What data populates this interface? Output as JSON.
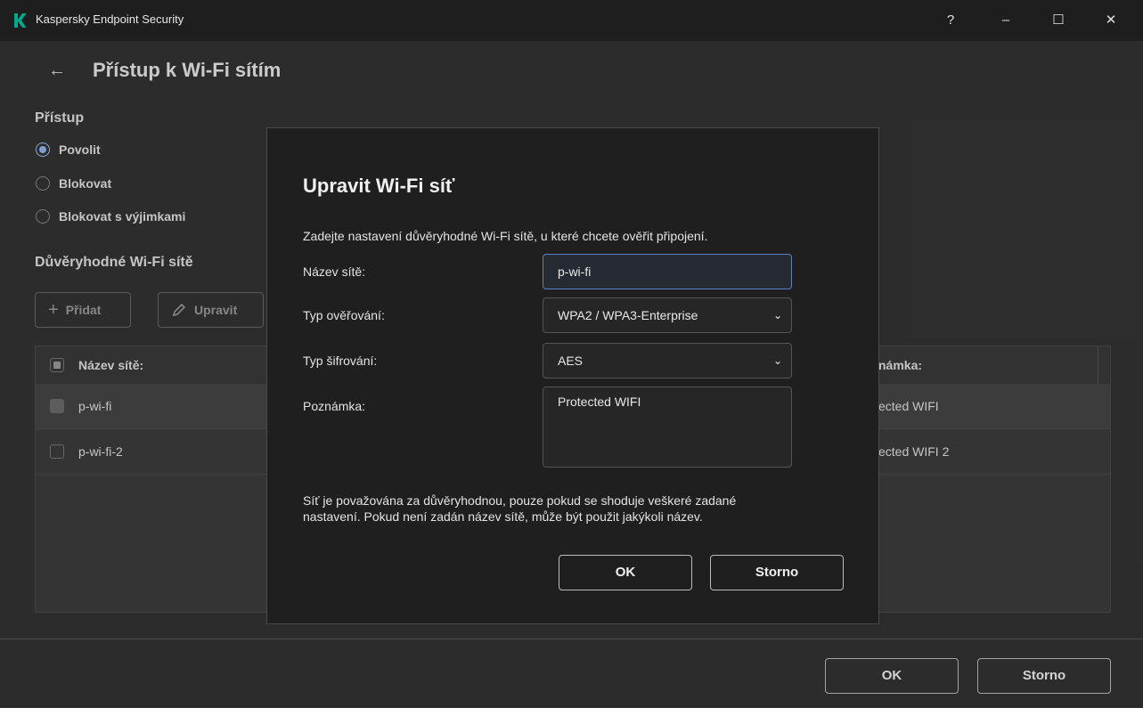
{
  "titlebar": {
    "app_title": "Kaspersky Endpoint Security",
    "help": "?",
    "minimize": "–",
    "maximize": "☐",
    "close": "✕"
  },
  "page": {
    "back_icon": "←",
    "title": "Přístup k Wi-Fi sítím"
  },
  "access": {
    "heading": "Přístup",
    "options": [
      {
        "label": "Povolit",
        "selected": true
      },
      {
        "label": "Blokovat",
        "selected": false
      },
      {
        "label": "Blokovat s výjimkami",
        "selected": false
      }
    ]
  },
  "trusted": {
    "heading": "Důvěryhodné Wi-Fi sítě",
    "add_label": "Přidat",
    "edit_label": "Upravit"
  },
  "table": {
    "col_name": "Název sítě:",
    "col_note_visible": "námka:",
    "rows": [
      {
        "name": "p-wi-fi",
        "note_visible": "ected WIFI",
        "checked": true
      },
      {
        "name": "p-wi-fi-2",
        "note_visible": "ected WIFI 2",
        "checked": false
      }
    ]
  },
  "footer": {
    "ok": "OK",
    "cancel": "Storno"
  },
  "dialog": {
    "title": "Upravit Wi-Fi síť",
    "description": "Zadejte nastavení důvěryhodné Wi-Fi sítě, u které chcete ověřit připojení.",
    "network_name_label": "Název sítě:",
    "network_name_value": "p-wi-fi",
    "auth_label": "Typ ověřování:",
    "auth_value": "WPA2 / WPA3-Enterprise",
    "encryption_label": "Typ šifrování:",
    "encryption_value": "AES",
    "note_label": "Poznámka:",
    "note_value": "Protected WIFI",
    "footnote_line1": "Síť je považována za důvěryhodnou, pouze pokud se shoduje veškeré zadané",
    "footnote_line2": "nastavení. Pokud není zadán název sítě, může být použit jakýkoli název.",
    "ok": "OK",
    "cancel": "Storno"
  },
  "colors": {
    "accent": "#8fb5ec",
    "logo": "#00a88e"
  }
}
